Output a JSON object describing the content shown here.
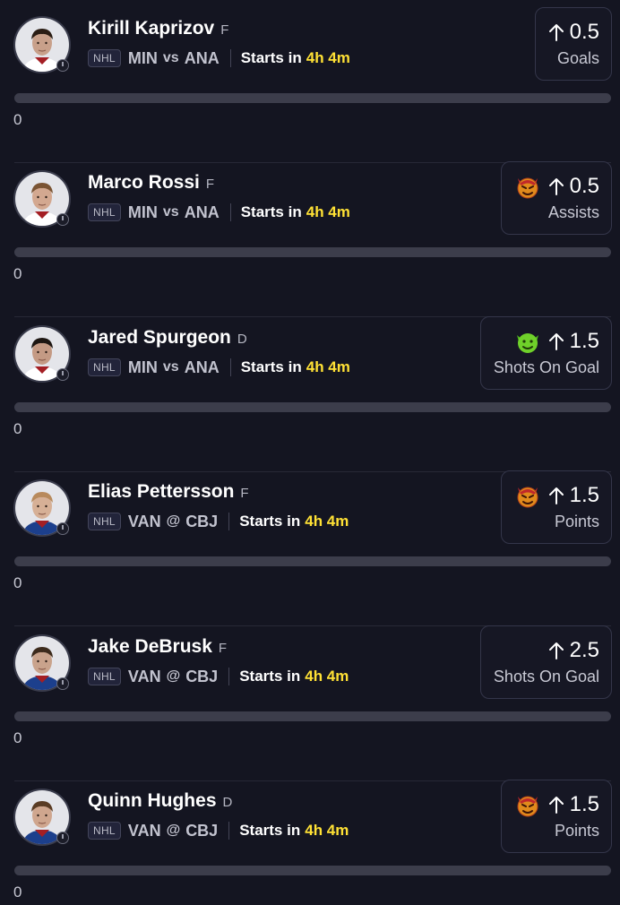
{
  "colors": {
    "background": "#141521",
    "accent_time": "#ffe135",
    "progress_track": "#3c3d4b",
    "card_border": "#34364a"
  },
  "cards": [
    {
      "name": "Kirill Kaprizov",
      "position": "F",
      "league": "NHL",
      "team": "MIN",
      "connector": "vs",
      "opponent": "ANA",
      "starts_label": "Starts in",
      "time": "4h 4m",
      "direction_icon": "arrow-up-icon",
      "line": "0.5",
      "stat": "Goals",
      "emoji": null,
      "progress_value": "0",
      "progress_fraction": 0
    },
    {
      "name": "Marco Rossi",
      "position": "F",
      "league": "NHL",
      "team": "MIN",
      "connector": "vs",
      "opponent": "ANA",
      "starts_label": "Starts in",
      "time": "4h 4m",
      "direction_icon": "arrow-up-icon",
      "line": "0.5",
      "stat": "Assists",
      "emoji": "devil-face-icon",
      "progress_value": "0",
      "progress_fraction": 0
    },
    {
      "name": "Jared Spurgeon",
      "position": "D",
      "league": "NHL",
      "team": "MIN",
      "connector": "vs",
      "opponent": "ANA",
      "starts_label": "Starts in",
      "time": "4h 4m",
      "direction_icon": "arrow-up-icon",
      "line": "1.5",
      "stat": "Shots On Goal",
      "emoji": "goblin-face-icon",
      "progress_value": "0",
      "progress_fraction": 0
    },
    {
      "name": "Elias Pettersson",
      "position": "F",
      "league": "NHL",
      "team": "VAN",
      "connector": "@",
      "opponent": "CBJ",
      "starts_label": "Starts in",
      "time": "4h 4m",
      "direction_icon": "arrow-up-icon",
      "line": "1.5",
      "stat": "Points",
      "emoji": "devil-face-icon",
      "progress_value": "0",
      "progress_fraction": 0
    },
    {
      "name": "Jake DeBrusk",
      "position": "F",
      "league": "NHL",
      "team": "VAN",
      "connector": "@",
      "opponent": "CBJ",
      "starts_label": "Starts in",
      "time": "4h 4m",
      "direction_icon": "arrow-up-icon",
      "line": "2.5",
      "stat": "Shots On Goal",
      "emoji": null,
      "progress_value": "0",
      "progress_fraction": 0
    },
    {
      "name": "Quinn Hughes",
      "position": "D",
      "league": "NHL",
      "team": "VAN",
      "connector": "@",
      "opponent": "CBJ",
      "starts_label": "Starts in",
      "time": "4h 4m",
      "direction_icon": "arrow-up-icon",
      "line": "1.5",
      "stat": "Points",
      "emoji": "devil-face-icon",
      "progress_value": "0",
      "progress_fraction": 0
    }
  ]
}
